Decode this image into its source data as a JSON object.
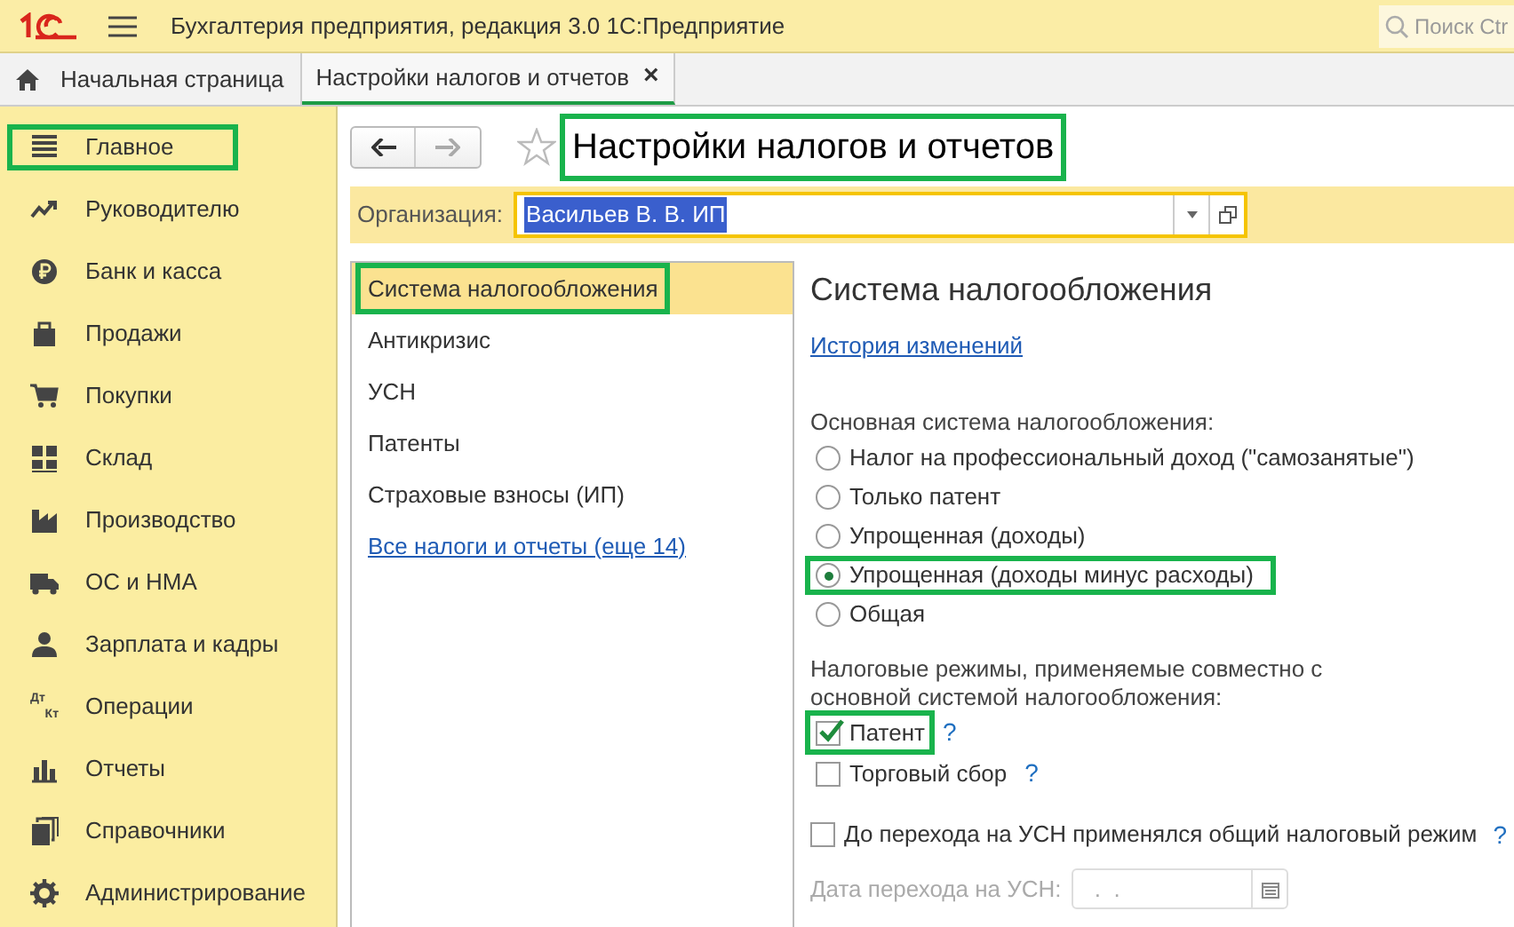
{
  "app_bar": {
    "title": "Бухгалтерия предприятия, редакция 3.0 1С:Предприятие",
    "search_placeholder": "Поиск Ctr"
  },
  "tabs": [
    {
      "label": "Начальная страница",
      "kind": "home",
      "selected": false
    },
    {
      "label": "Настройки налогов и отчетов",
      "kind": "doc",
      "selected": true,
      "close": "×"
    }
  ],
  "sidebar": {
    "items": [
      {
        "label": "Главное",
        "highlighted": true
      },
      {
        "label": "Руководителю",
        "highlighted": false
      },
      {
        "label": "Банк и касса",
        "highlighted": false
      },
      {
        "label": "Продажи",
        "highlighted": false
      },
      {
        "label": "Покупки",
        "highlighted": false
      },
      {
        "label": "Склад",
        "highlighted": false
      },
      {
        "label": "Производство",
        "highlighted": false
      },
      {
        "label": "ОС и НМА",
        "highlighted": false
      },
      {
        "label": "Зарплата и кадры",
        "highlighted": false
      },
      {
        "label": "Операции",
        "dt": "Дт",
        "kt": "Кт",
        "highlighted": false
      },
      {
        "label": "Отчеты",
        "highlighted": false
      },
      {
        "label": "Справочники",
        "highlighted": false
      },
      {
        "label": "Администрирование",
        "highlighted": false
      }
    ]
  },
  "form": {
    "title": "Настройки налогов и отчетов",
    "title_highlighted": true,
    "organization": {
      "label": "Организация:",
      "value": "Васильев В. В. ИП"
    },
    "sections": [
      {
        "label": "Система налогообложения",
        "kind": "item",
        "selected": true,
        "highlighted": true
      },
      {
        "label": "Антикризис",
        "kind": "item",
        "selected": false,
        "highlighted": false
      },
      {
        "label": "УСН",
        "kind": "item",
        "selected": false,
        "highlighted": false
      },
      {
        "label": "Патенты",
        "kind": "item",
        "selected": false,
        "highlighted": false
      },
      {
        "label": "Страховые взносы (ИП)",
        "kind": "item",
        "selected": false,
        "highlighted": false
      },
      {
        "label": "Все налоги и отчеты (еще 14)",
        "kind": "link",
        "selected": false,
        "highlighted": false
      }
    ],
    "heading": "Система налогообложения",
    "history_link": "История изменений",
    "main_system_label": "Основная система налогообложения:",
    "main_system_options": [
      {
        "label": "Налог на профессиональный доход (\"самозанятые\")",
        "selected": false,
        "highlighted": false
      },
      {
        "label": "Только патент",
        "selected": false,
        "highlighted": false
      },
      {
        "label": "Упрощенная (доходы)",
        "selected": false,
        "highlighted": false
      },
      {
        "label": "Упрощенная (доходы минус расходы)",
        "selected": true,
        "highlighted": true
      },
      {
        "label": "Общая",
        "selected": false,
        "highlighted": false
      }
    ],
    "combined_label": "Налоговые режимы, применяемые совместно с основной системой налогообложения:",
    "combined_options": [
      {
        "label": "Патент",
        "checked": true,
        "highlighted": true,
        "help": "?"
      },
      {
        "label": "Торговый сбор",
        "checked": false,
        "highlighted": false,
        "help": "?"
      }
    ],
    "general_regime": {
      "label": "До перехода на УСН применялся общий налоговый режим",
      "checked": false,
      "help": "?"
    },
    "transition_date": {
      "label": "Дата перехода на УСН:",
      "value": " .  .",
      "disabled": true
    }
  }
}
